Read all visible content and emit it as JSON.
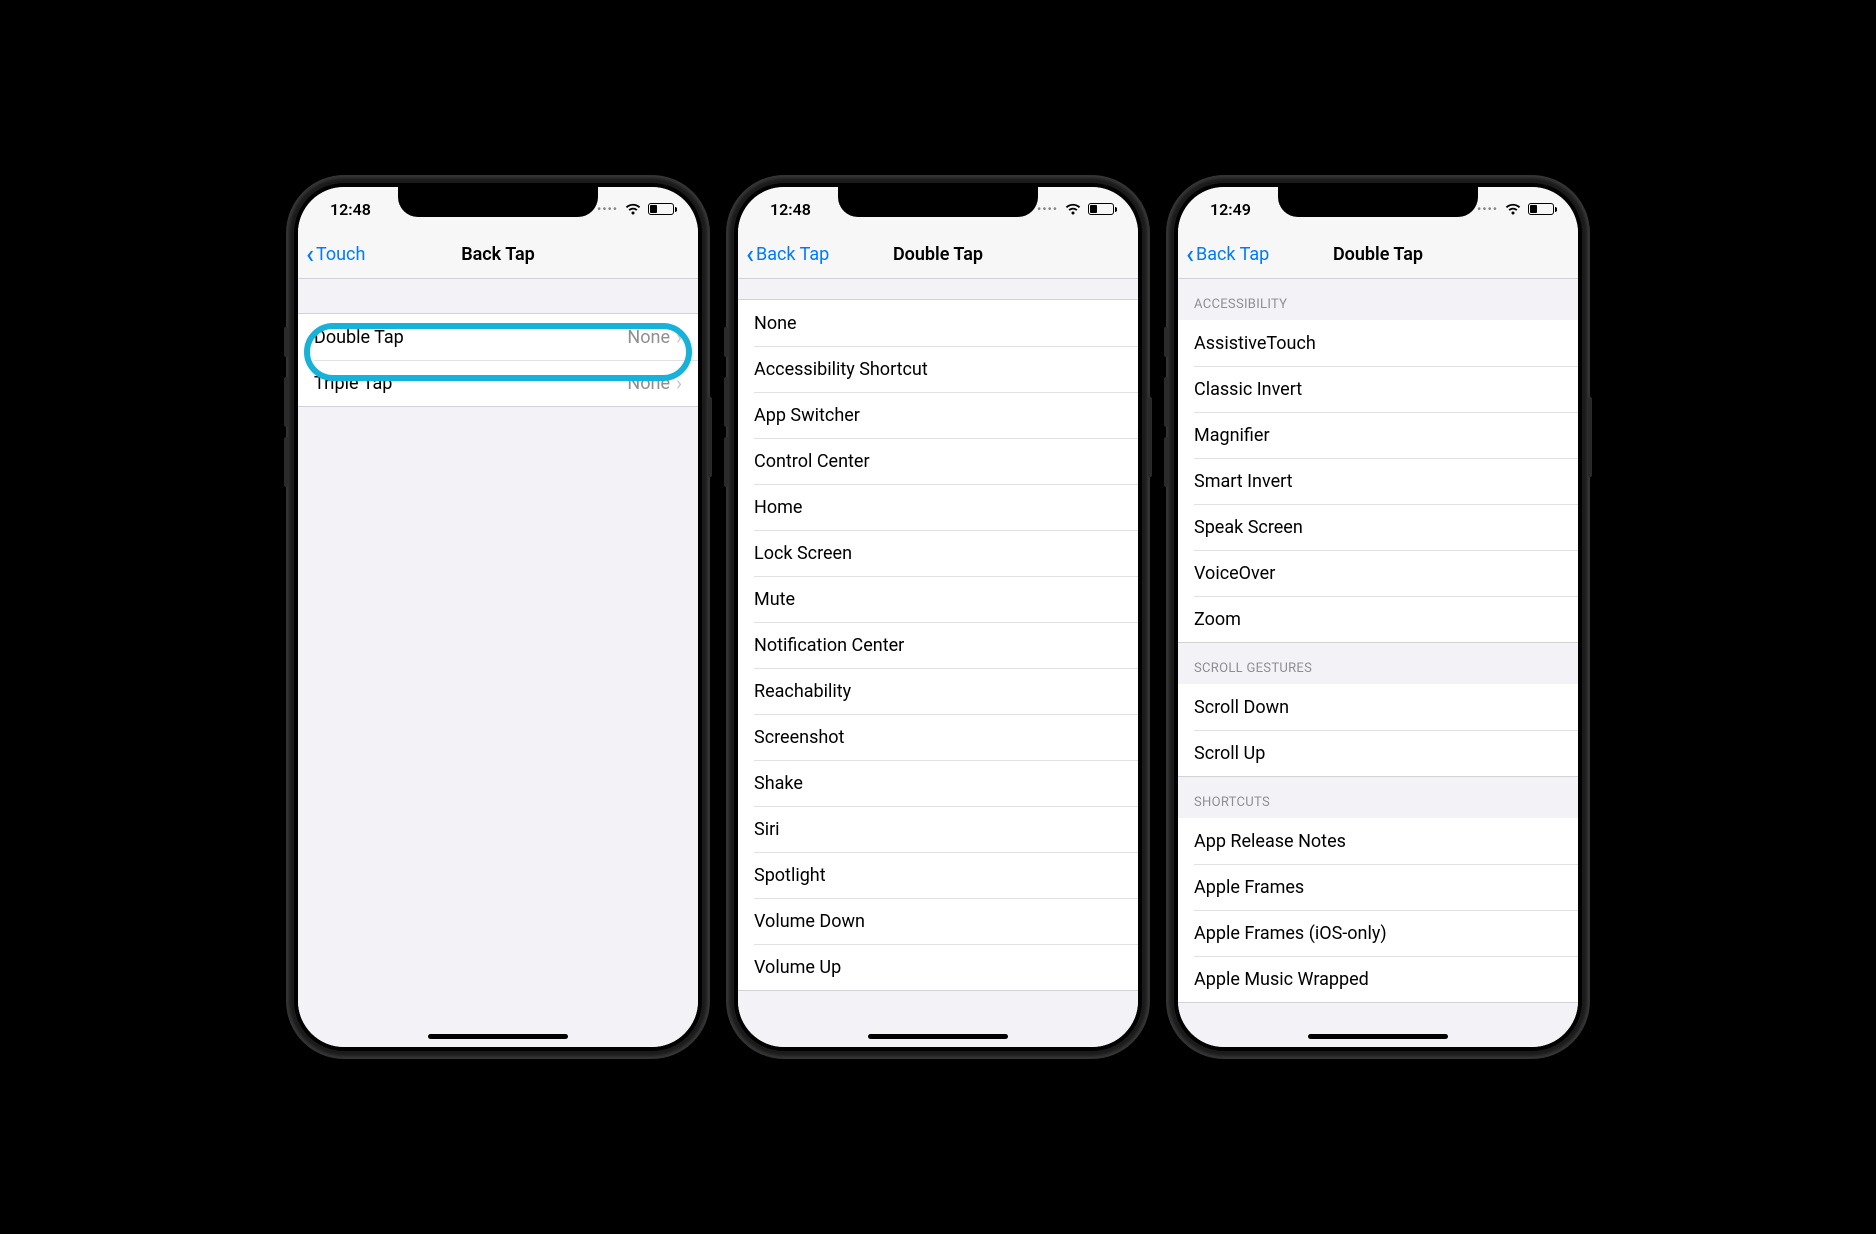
{
  "phones": [
    {
      "time": "12:48",
      "backLabel": "Touch",
      "title": "Back Tap",
      "highlightRing": true,
      "sections": [
        {
          "header": null,
          "rows": [
            {
              "label": "Double Tap",
              "detail": "None",
              "disclosure": true
            },
            {
              "label": "Triple Tap",
              "detail": "None",
              "disclosure": true
            }
          ]
        }
      ]
    },
    {
      "time": "12:48",
      "backLabel": "Back Tap",
      "title": "Double Tap",
      "highlightRing": false,
      "sections": [
        {
          "header": null,
          "flushTop": true,
          "rows": [
            {
              "label": "None"
            },
            {
              "label": "Accessibility Shortcut"
            },
            {
              "label": "App Switcher"
            },
            {
              "label": "Control Center"
            },
            {
              "label": "Home"
            },
            {
              "label": "Lock Screen"
            },
            {
              "label": "Mute"
            },
            {
              "label": "Notification Center"
            },
            {
              "label": "Reachability"
            },
            {
              "label": "Screenshot"
            },
            {
              "label": "Shake"
            },
            {
              "label": "Siri"
            },
            {
              "label": "Spotlight"
            },
            {
              "label": "Volume Down"
            },
            {
              "label": "Volume Up"
            }
          ]
        }
      ]
    },
    {
      "time": "12:49",
      "backLabel": "Back Tap",
      "title": "Double Tap",
      "highlightRing": false,
      "sections": [
        {
          "header": "Accessibility",
          "flushTop": true,
          "rows": [
            {
              "label": "AssistiveTouch"
            },
            {
              "label": "Classic Invert"
            },
            {
              "label": "Magnifier"
            },
            {
              "label": "Smart Invert"
            },
            {
              "label": "Speak Screen"
            },
            {
              "label": "VoiceOver"
            },
            {
              "label": "Zoom"
            }
          ]
        },
        {
          "header": "Scroll Gestures",
          "rows": [
            {
              "label": "Scroll Down"
            },
            {
              "label": "Scroll Up"
            }
          ]
        },
        {
          "header": "Shortcuts",
          "rows": [
            {
              "label": "App Release Notes"
            },
            {
              "label": "Apple Frames"
            },
            {
              "label": "Apple Frames (iOS-only)"
            },
            {
              "label": "Apple Music Wrapped"
            }
          ]
        }
      ]
    }
  ]
}
